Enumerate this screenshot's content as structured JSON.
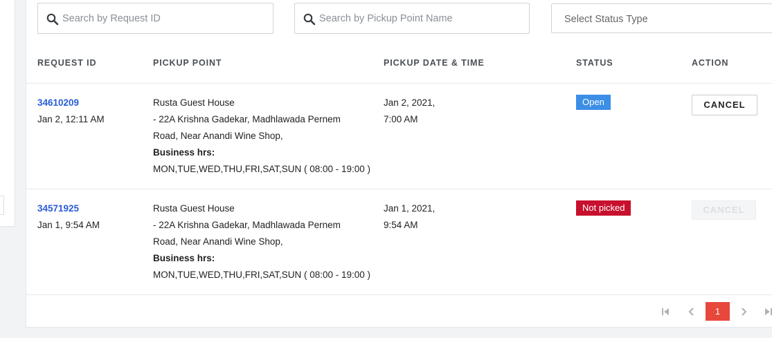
{
  "filters": {
    "search_request_placeholder": "Search by Request ID",
    "search_pickup_placeholder": "Search by Pickup Point Name",
    "status_select_label": "Select Status Type"
  },
  "table": {
    "headers": {
      "request_id": "REQUEST ID",
      "pickup_point": "PICKUP POINT",
      "pickup_datetime": "PICKUP DATE & TIME",
      "status": "STATUS",
      "action": "ACTION"
    },
    "rows": [
      {
        "request_id": "34610209",
        "request_date": "Jan 2, 12:11 AM",
        "pickup_name": "Rusta Guest House",
        "address_line1": "- 22A Krishna Gadekar, Madhlawada Pernem",
        "address_line2": "Road, Near Anandi Wine Shop,",
        "business_label": "Business hrs:",
        "business_hours": "MON,TUE,WED,THU,FRI,SAT,SUN ( 08:00 - 19:00 )",
        "pickup_date": "Jan 2, 2021,",
        "pickup_time": "7:00 AM",
        "status": "Open",
        "action": "CANCEL"
      },
      {
        "request_id": "34571925",
        "request_date": "Jan 1, 9:54 AM",
        "pickup_name": "Rusta Guest House",
        "address_line1": "- 22A Krishna Gadekar, Madhlawada Pernem",
        "address_line2": "Road, Near Anandi Wine Shop,",
        "business_label": "Business hrs:",
        "business_hours": "MON,TUE,WED,THU,FRI,SAT,SUN ( 08:00 - 19:00 )",
        "pickup_date": "Jan 1, 2021,",
        "pickup_time": "9:54 AM",
        "status": "Not picked",
        "action": "CANCEL"
      }
    ]
  },
  "pagination": {
    "first_icon": "first-page-icon",
    "prev_icon": "chevron-left-icon",
    "current_page": "1",
    "next_icon": "chevron-right-icon",
    "last_icon": "last-page-icon"
  },
  "colors": {
    "link": "#2a5bd7",
    "badge_open": "#3c8ee6",
    "badge_not_picked": "#c8102e",
    "page_active": "#e8473c"
  }
}
